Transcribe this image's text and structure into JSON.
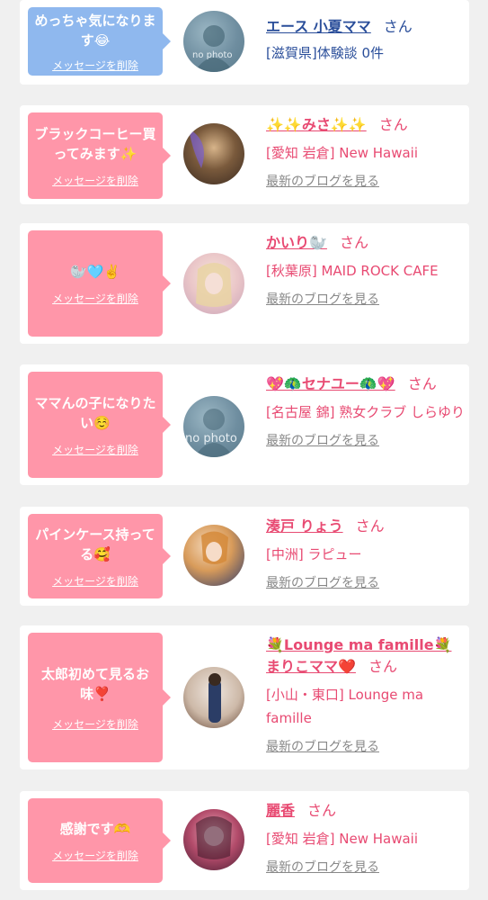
{
  "cards": [
    {
      "message": "めっちゃ気になります😂",
      "delete_label": "メッセージを削除",
      "name": "エース 小夏ママ",
      "honorific": "さん",
      "shop": "[滋賀県]体験談 0件",
      "avatar_label": "no photo",
      "style": "blue"
    },
    {
      "message": "ブラックコーヒー買ってみます✨",
      "delete_label": "メッセージを削除",
      "name": "✨✨みさ✨✨",
      "honorific": "さん",
      "shop": "[愛知 岩倉] New Hawaii",
      "blog_label": "最新のブログを見る",
      "style": "pink"
    },
    {
      "message": "🦭🩵✌️",
      "delete_label": "メッセージを削除",
      "name": "かいり🦭",
      "honorific": "さん",
      "shop": "[秋葉原] MAID ROCK CAFE",
      "blog_label": "最新のブログを見る",
      "style": "pink"
    },
    {
      "message": "ママんの子になりたい☺️",
      "delete_label": "メッセージを削除",
      "name": "💖🦚セナユー🦚💖",
      "honorific": "さん",
      "shop": "[名古屋 錦] 熟女クラブ しらゆり",
      "blog_label": "最新のブログを見る",
      "avatar_label": "no photo",
      "style": "pink"
    },
    {
      "message": "パインケース持ってる🥰",
      "delete_label": "メッセージを削除",
      "name": "湊戸 りょう",
      "honorific": "さん",
      "shop": "[中洲] ラピュー",
      "blog_label": "最新のブログを見る",
      "style": "pink"
    },
    {
      "message": "太郎初めて見るお味❣️",
      "delete_label": "メッセージを削除",
      "name": "💐Lounge ma famille💐まりこママ❤️",
      "honorific": "さん",
      "shop": "[小山・東口] Lounge ma famille",
      "blog_label": "最新のブログを見る",
      "style": "pink"
    },
    {
      "message": "感謝です🫶",
      "delete_label": "メッセージを削除",
      "name": "麗香",
      "honorific": "さん",
      "shop": "[愛知 岩倉] New Hawaii",
      "blog_label": "最新のブログを見る",
      "style": "pink"
    }
  ],
  "colors": {
    "bubble_pink": "#ff96a9",
    "bubble_blue": "#8fb8ee",
    "name_pink": "#e84a72",
    "name_blue": "#2a4e9a",
    "blog_gray": "#888888",
    "background": "#f0f0f0"
  },
  "icons": {
    "avatar": "profile-photo"
  }
}
